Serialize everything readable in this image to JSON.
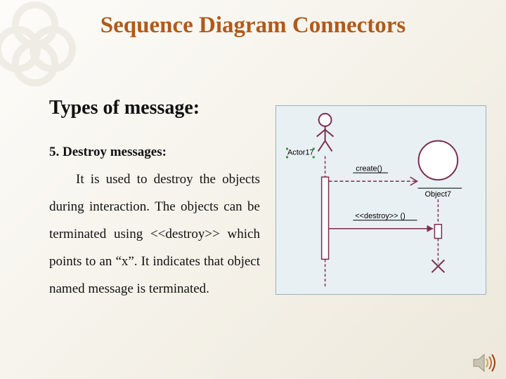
{
  "title": "Sequence Diagram Connectors",
  "subheading": "Types of message:",
  "item_label": "5. Destroy messages:",
  "body": "It is used to destroy the objects during interaction. The objects can be terminated using <<destroy>> which points to an “x”. It indicates that object named message is terminated.",
  "diagram": {
    "actor_label": "Actor17",
    "object_label": "Object7",
    "create_msg": "create()",
    "destroy_msg": "<<destroy>> ()"
  }
}
